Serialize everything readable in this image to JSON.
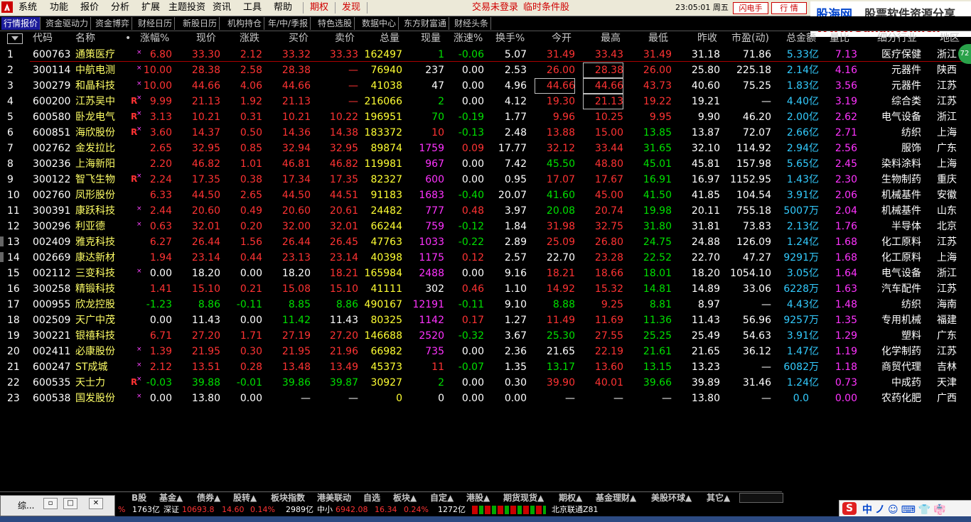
{
  "menubar": {
    "items": [
      "系统",
      "功能",
      "报价",
      "分析",
      "扩展",
      "主题投资",
      "资讯",
      "工具",
      "帮助"
    ],
    "red_items": [
      "期权",
      "发现"
    ],
    "notices": [
      "交易未登录",
      "临时条件股"
    ],
    "clock": "23:05:01 周五",
    "buttons": [
      "闪电手",
      "行 情"
    ]
  },
  "watermark": {
    "line1a": "股海网",
    "line1b": "股票软件资源分享",
    "line2": "Www.Guhai.com.cn"
  },
  "tabs": [
    "行情报价",
    "资金驱动力",
    "资金博弈",
    "财经日历",
    "新股日历",
    "机构持仓",
    "年/中/季报",
    "特色选股",
    "数据中心",
    "东方财富通",
    "财经头条"
  ],
  "columns": [
    "代码",
    "名称",
    "涨幅%",
    "现价",
    "涨跌",
    "买价",
    "卖价",
    "总量",
    "现量",
    "涨速%",
    "换手%",
    "今开",
    "最高",
    "最低",
    "昨收",
    "市盈(动)",
    "总金额",
    "量比",
    "细分行业",
    "地区"
  ],
  "rows": [
    {
      "i": "1",
      "code": "600763",
      "name": "通策医疗",
      "mk": "×",
      "R": "",
      "pct": "6.80",
      "price": "33.30",
      "chg": "2.12",
      "bid": "33.32",
      "ask": "33.33",
      "vol": "162497",
      "cur": "1",
      "curc": "green",
      "spd": "-0.06",
      "spdc": "green",
      "turn": "5.07",
      "open": "31.49",
      "openc": "red",
      "high": "33.43",
      "highc": "red",
      "low": "31.49",
      "lowc": "red",
      "prev": "31.18",
      "pe": "71.86",
      "amt": "5.33",
      "unit": "亿",
      "vr": "7.13",
      "ind": "医疗保健",
      "reg": "浙江",
      "col": "red"
    },
    {
      "i": "2",
      "code": "300114",
      "name": "中航电测",
      "mk": "×",
      "R": "",
      "pct": "10.00",
      "price": "28.38",
      "chg": "2.58",
      "bid": "28.38",
      "ask": "—",
      "vol": "76940",
      "cur": "237",
      "curc": "white",
      "spd": "0.00",
      "spdc": "white",
      "turn": "2.53",
      "open": "26.00",
      "openc": "red",
      "high": "28.38",
      "highc": "red",
      "low": "26.00",
      "lowc": "red",
      "prev": "25.80",
      "pe": "225.18",
      "amt": "2.14",
      "unit": "亿",
      "vr": "4.16",
      "ind": "元器件",
      "reg": "陕西",
      "col": "red"
    },
    {
      "i": "3",
      "code": "300279",
      "name": "和晶科技",
      "mk": "×",
      "R": "",
      "pct": "10.00",
      "price": "44.66",
      "chg": "4.06",
      "bid": "44.66",
      "ask": "—",
      "vol": "41038",
      "cur": "47",
      "curc": "white",
      "spd": "0.00",
      "spdc": "white",
      "turn": "4.96",
      "open": "44.66",
      "openc": "red",
      "high": "44.66",
      "highc": "red",
      "low": "43.73",
      "lowc": "red",
      "prev": "40.60",
      "pe": "75.25",
      "amt": "1.83",
      "unit": "亿",
      "vr": "3.56",
      "ind": "元器件",
      "reg": "江苏",
      "col": "red"
    },
    {
      "i": "4",
      "code": "600200",
      "name": "江苏吴中",
      "mk": "×",
      "R": "R",
      "pct": "9.99",
      "price": "21.13",
      "chg": "1.92",
      "bid": "21.13",
      "ask": "—",
      "vol": "216066",
      "cur": "2",
      "curc": "green",
      "spd": "0.00",
      "spdc": "white",
      "turn": "4.12",
      "open": "19.30",
      "openc": "red",
      "high": "21.13",
      "highc": "red",
      "low": "19.22",
      "lowc": "red",
      "prev": "19.21",
      "pe": "—",
      "amt": "4.40",
      "unit": "亿",
      "vr": "3.19",
      "ind": "综合类",
      "reg": "江苏",
      "col": "red"
    },
    {
      "i": "5",
      "code": "600580",
      "name": "卧龙电气",
      "mk": "×",
      "R": "R",
      "pct": "3.13",
      "price": "10.21",
      "chg": "0.31",
      "bid": "10.21",
      "ask": "10.22",
      "vol": "196951",
      "cur": "70",
      "curc": "green",
      "spd": "-0.19",
      "spdc": "green",
      "turn": "1.77",
      "open": "9.96",
      "openc": "red",
      "high": "10.25",
      "highc": "red",
      "low": "9.95",
      "lowc": "red",
      "prev": "9.90",
      "pe": "46.20",
      "amt": "2.00",
      "unit": "亿",
      "vr": "2.62",
      "ind": "电气设备",
      "reg": "浙江",
      "col": "red"
    },
    {
      "i": "6",
      "code": "600851",
      "name": "海欣股份",
      "mk": "×",
      "R": "R",
      "pct": "3.60",
      "price": "14.37",
      "chg": "0.50",
      "bid": "14.36",
      "ask": "14.38",
      "vol": "183372",
      "cur": "10",
      "curc": "red",
      "spd": "-0.13",
      "spdc": "green",
      "turn": "2.48",
      "open": "13.88",
      "openc": "red",
      "high": "15.00",
      "highc": "red",
      "low": "13.85",
      "lowc": "green",
      "prev": "13.87",
      "pe": "72.07",
      "amt": "2.66",
      "unit": "亿",
      "vr": "2.71",
      "ind": "纺织",
      "reg": "上海",
      "col": "red"
    },
    {
      "i": "7",
      "code": "002762",
      "name": "金发拉比",
      "mk": "",
      "R": "",
      "pct": "2.65",
      "price": "32.95",
      "chg": "0.85",
      "bid": "32.94",
      "ask": "32.95",
      "vol": "89874",
      "cur": "1759",
      "curc": "magenta",
      "spd": "0.09",
      "spdc": "red",
      "turn": "17.77",
      "open": "32.12",
      "openc": "red",
      "high": "33.44",
      "highc": "red",
      "low": "31.65",
      "lowc": "green",
      "prev": "32.10",
      "pe": "114.92",
      "amt": "2.94",
      "unit": "亿",
      "vr": "2.56",
      "ind": "服饰",
      "reg": "广东",
      "col": "red"
    },
    {
      "i": "8",
      "code": "300236",
      "name": "上海新阳",
      "mk": "",
      "R": "",
      "pct": "2.20",
      "price": "46.82",
      "chg": "1.01",
      "bid": "46.81",
      "ask": "46.82",
      "vol": "119981",
      "cur": "967",
      "curc": "magenta",
      "spd": "0.00",
      "spdc": "white",
      "turn": "7.42",
      "open": "45.50",
      "openc": "green",
      "high": "48.80",
      "highc": "red",
      "low": "45.01",
      "lowc": "green",
      "prev": "45.81",
      "pe": "157.98",
      "amt": "5.65",
      "unit": "亿",
      "vr": "2.45",
      "ind": "染料涂料",
      "reg": "上海",
      "col": "red"
    },
    {
      "i": "9",
      "code": "300122",
      "name": "智飞生物",
      "mk": "×",
      "R": "R",
      "pct": "2.24",
      "price": "17.35",
      "chg": "0.38",
      "bid": "17.34",
      "ask": "17.35",
      "vol": "82327",
      "cur": "600",
      "curc": "magenta",
      "spd": "0.00",
      "spdc": "white",
      "turn": "0.95",
      "open": "17.07",
      "openc": "red",
      "high": "17.67",
      "highc": "red",
      "low": "16.91",
      "lowc": "green",
      "prev": "16.97",
      "pe": "1152.95",
      "amt": "1.43",
      "unit": "亿",
      "vr": "2.30",
      "ind": "生物制药",
      "reg": "重庆",
      "col": "red"
    },
    {
      "i": "10",
      "code": "002760",
      "name": "凤形股份",
      "mk": "",
      "R": "",
      "pct": "6.33",
      "price": "44.50",
      "chg": "2.65",
      "bid": "44.50",
      "ask": "44.51",
      "vol": "91183",
      "cur": "1683",
      "curc": "magenta",
      "spd": "-0.40",
      "spdc": "green",
      "turn": "20.07",
      "open": "41.60",
      "openc": "green",
      "high": "45.00",
      "highc": "red",
      "low": "41.50",
      "lowc": "green",
      "prev": "41.85",
      "pe": "104.54",
      "amt": "3.91",
      "unit": "亿",
      "vr": "2.06",
      "ind": "机械基件",
      "reg": "安徽",
      "col": "red"
    },
    {
      "i": "11",
      "code": "300391",
      "name": "康跃科技",
      "mk": "×",
      "R": "",
      "pct": "2.44",
      "price": "20.60",
      "chg": "0.49",
      "bid": "20.60",
      "ask": "20.61",
      "vol": "24482",
      "cur": "777",
      "curc": "magenta",
      "spd": "0.48",
      "spdc": "red",
      "turn": "3.97",
      "open": "20.08",
      "openc": "green",
      "high": "20.74",
      "highc": "red",
      "low": "19.98",
      "lowc": "green",
      "prev": "20.11",
      "pe": "755.18",
      "amt": "5007",
      "unit": "万",
      "vr": "2.04",
      "ind": "机械基件",
      "reg": "山东",
      "col": "red"
    },
    {
      "i": "12",
      "code": "300296",
      "name": "利亚德",
      "mk": "×",
      "R": "",
      "pct": "0.63",
      "price": "32.01",
      "chg": "0.20",
      "bid": "32.00",
      "ask": "32.01",
      "vol": "66244",
      "cur": "759",
      "curc": "magenta",
      "spd": "-0.12",
      "spdc": "green",
      "turn": "1.84",
      "open": "31.98",
      "openc": "red",
      "high": "32.75",
      "highc": "red",
      "low": "31.80",
      "lowc": "green",
      "prev": "31.81",
      "pe": "73.83",
      "amt": "2.13",
      "unit": "亿",
      "vr": "1.76",
      "ind": "半导体",
      "reg": "北京",
      "col": "red"
    },
    {
      "i": "13",
      "code": "002409",
      "name": "雅克科技",
      "mk": "",
      "R": "",
      "pct": "6.27",
      "price": "26.44",
      "chg": "1.56",
      "bid": "26.44",
      "ask": "26.45",
      "vol": "47763",
      "cur": "1033",
      "curc": "magenta",
      "spd": "-0.22",
      "spdc": "green",
      "turn": "2.89",
      "open": "25.09",
      "openc": "red",
      "high": "26.80",
      "highc": "red",
      "low": "24.75",
      "lowc": "green",
      "prev": "24.88",
      "pe": "126.09",
      "amt": "1.24",
      "unit": "亿",
      "vr": "1.68",
      "ind": "化工原料",
      "reg": "江苏",
      "col": "red"
    },
    {
      "i": "14",
      "code": "002669",
      "name": "康达新材",
      "mk": "",
      "R": "",
      "pct": "1.94",
      "price": "23.14",
      "chg": "0.44",
      "bid": "23.13",
      "ask": "23.14",
      "vol": "40398",
      "cur": "1175",
      "curc": "magenta",
      "spd": "0.12",
      "spdc": "red",
      "turn": "2.57",
      "open": "22.70",
      "openc": "white",
      "high": "23.28",
      "highc": "red",
      "low": "22.52",
      "lowc": "green",
      "prev": "22.70",
      "pe": "47.27",
      "amt": "9291",
      "unit": "万",
      "vr": "1.68",
      "ind": "化工原料",
      "reg": "上海",
      "col": "red"
    },
    {
      "i": "15",
      "code": "002112",
      "name": "三变科技",
      "mk": "×",
      "R": "",
      "pct": "0.00",
      "price": "18.20",
      "chg": "0.00",
      "bid": "18.20",
      "ask": "18.21",
      "vol": "165984",
      "cur": "2488",
      "curc": "magenta",
      "spd": "0.00",
      "spdc": "white",
      "turn": "9.16",
      "open": "18.21",
      "openc": "red",
      "high": "18.66",
      "highc": "red",
      "low": "18.01",
      "lowc": "green",
      "prev": "18.20",
      "pe": "1054.10",
      "amt": "3.05",
      "unit": "亿",
      "vr": "1.64",
      "ind": "电气设备",
      "reg": "浙江",
      "col": "white",
      "askc": "red",
      "bidc": "white"
    },
    {
      "i": "16",
      "code": "300258",
      "name": "精锻科技",
      "mk": "",
      "R": "",
      "pct": "1.41",
      "price": "15.10",
      "chg": "0.21",
      "bid": "15.08",
      "ask": "15.10",
      "vol": "41111",
      "cur": "302",
      "curc": "white",
      "spd": "0.46",
      "spdc": "red",
      "turn": "1.10",
      "open": "14.92",
      "openc": "red",
      "high": "15.32",
      "highc": "red",
      "low": "14.81",
      "lowc": "green",
      "prev": "14.89",
      "pe": "33.06",
      "amt": "6228",
      "unit": "万",
      "vr": "1.63",
      "ind": "汽车配件",
      "reg": "江苏",
      "col": "red"
    },
    {
      "i": "17",
      "code": "000955",
      "name": "欣龙控股",
      "mk": "",
      "R": "",
      "pct": "-1.23",
      "price": "8.86",
      "chg": "-0.11",
      "bid": "8.85",
      "ask": "8.86",
      "vol": "490167",
      "cur": "12191",
      "curc": "magenta",
      "spd": "-0.11",
      "spdc": "green",
      "turn": "9.10",
      "open": "8.88",
      "openc": "green",
      "high": "9.25",
      "highc": "red",
      "low": "8.81",
      "lowc": "green",
      "prev": "8.97",
      "pe": "—",
      "amt": "4.43",
      "unit": "亿",
      "vr": "1.48",
      "ind": "纺织",
      "reg": "海南",
      "col": "green"
    },
    {
      "i": "18",
      "code": "002509",
      "name": "天广中茂",
      "mk": "",
      "R": "",
      "pct": "0.00",
      "price": "11.43",
      "chg": "0.00",
      "bid": "11.42",
      "ask": "11.43",
      "vol": "80325",
      "cur": "1142",
      "curc": "magenta",
      "spd": "0.17",
      "spdc": "red",
      "turn": "1.27",
      "open": "11.49",
      "openc": "red",
      "high": "11.69",
      "highc": "red",
      "low": "11.36",
      "lowc": "green",
      "prev": "11.43",
      "pe": "56.96",
      "amt": "9257",
      "unit": "万",
      "vr": "1.35",
      "ind": "专用机械",
      "reg": "福建",
      "col": "white",
      "bidc": "green",
      "askc": "white"
    },
    {
      "i": "19",
      "code": "300221",
      "name": "银禧科技",
      "mk": "",
      "R": "",
      "pct": "6.71",
      "price": "27.20",
      "chg": "1.71",
      "bid": "27.19",
      "ask": "27.20",
      "vol": "146688",
      "cur": "2520",
      "curc": "magenta",
      "spd": "-0.32",
      "spdc": "green",
      "turn": "3.67",
      "open": "25.30",
      "openc": "green",
      "high": "27.55",
      "highc": "red",
      "low": "25.25",
      "lowc": "green",
      "prev": "25.49",
      "pe": "54.63",
      "amt": "3.91",
      "unit": "亿",
      "vr": "1.29",
      "ind": "塑料",
      "reg": "广东",
      "col": "red"
    },
    {
      "i": "20",
      "code": "002411",
      "name": "必康股份",
      "mk": "×",
      "R": "",
      "pct": "1.39",
      "price": "21.95",
      "chg": "0.30",
      "bid": "21.95",
      "ask": "21.96",
      "vol": "66982",
      "cur": "735",
      "curc": "magenta",
      "spd": "0.00",
      "spdc": "white",
      "turn": "2.36",
      "open": "21.65",
      "openc": "white",
      "high": "22.19",
      "highc": "red",
      "low": "21.61",
      "lowc": "green",
      "prev": "21.65",
      "pe": "36.12",
      "amt": "1.47",
      "unit": "亿",
      "vr": "1.19",
      "ind": "化学制药",
      "reg": "江苏",
      "col": "red"
    },
    {
      "i": "21",
      "code": "600247",
      "name": "ST成城",
      "mk": "×",
      "R": "",
      "pct": "2.12",
      "price": "13.51",
      "chg": "0.28",
      "bid": "13.48",
      "ask": "13.49",
      "vol": "45373",
      "cur": "11",
      "curc": "red",
      "spd": "-0.07",
      "spdc": "green",
      "turn": "1.35",
      "open": "13.17",
      "openc": "green",
      "high": "13.60",
      "highc": "red",
      "low": "13.15",
      "lowc": "green",
      "prev": "13.23",
      "pe": "—",
      "amt": "6082",
      "unit": "万",
      "vr": "1.18",
      "ind": "商贸代理",
      "reg": "吉林",
      "col": "red"
    },
    {
      "i": "22",
      "code": "600535",
      "name": "天士力",
      "mk": "×",
      "R": "R",
      "pct": "-0.03",
      "price": "39.88",
      "chg": "-0.01",
      "bid": "39.86",
      "ask": "39.87",
      "vol": "30927",
      "cur": "2",
      "curc": "green",
      "spd": "0.00",
      "spdc": "white",
      "turn": "0.30",
      "open": "39.90",
      "openc": "red",
      "high": "40.01",
      "highc": "red",
      "low": "39.66",
      "lowc": "green",
      "prev": "39.89",
      "pe": "31.46",
      "amt": "1.24",
      "unit": "亿",
      "vr": "0.73",
      "ind": "中成药",
      "reg": "天津",
      "col": "green"
    },
    {
      "i": "23",
      "code": "600538",
      "name": "国发股份",
      "mk": "×",
      "R": "",
      "pct": "0.00",
      "price": "13.80",
      "chg": "0.00",
      "bid": "—",
      "ask": "—",
      "vol": "0",
      "cur": "0",
      "curc": "white",
      "spd": "0.00",
      "spdc": "white",
      "turn": "0.00",
      "open": "—",
      "openc": "white",
      "high": "—",
      "highc": "white",
      "low": "—",
      "lowc": "white",
      "prev": "13.80",
      "pe": "—",
      "amt": "0.0",
      "unit": "",
      "vr": "0.00",
      "ind": "农药化肥",
      "reg": "广西",
      "col": "white"
    }
  ],
  "bottom_tabs": [
    "B股",
    "基金▲",
    "债券▲",
    "股转▲",
    "板块指数",
    "港美联动",
    "自选",
    "板块▲",
    "自定▲",
    "港股▲",
    "期货现货▲",
    "期权▲",
    "基金理财▲",
    "美股环球▲",
    "其它▲"
  ],
  "status": {
    "a_amt": "1763亿",
    "sz_label": "深证",
    "sz_val": "10693.8",
    "sz_chg": "14.60",
    "sz_pct": "0.14%",
    "sz_amt": "2989亿",
    "zx_label": "中小",
    "zx_val": "6942.08",
    "zx_chg": "16.34",
    "zx_pct": "0.24%",
    "zx_amt": "1272亿",
    "net": "北京联通Z81",
    "left_pct": "%"
  },
  "popup": {
    "label": "综..."
  },
  "tray": {
    "text": "中ノ☺⌨👕👘"
  },
  "badge": "72"
}
